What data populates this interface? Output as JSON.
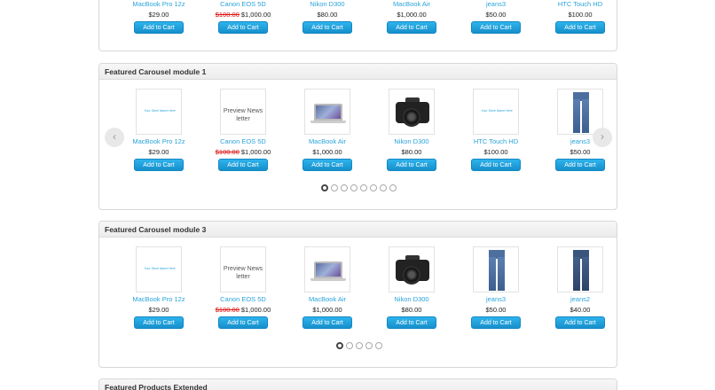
{
  "top_row": {
    "products": [
      {
        "name": "MacBook Pro 12z",
        "price": "$29.00",
        "old_price": "",
        "button": "Add to Cart"
      },
      {
        "name": "Canon EOS 5D",
        "price": "$1,000.00",
        "old_price": "$100.00",
        "button": "Add to Cart"
      },
      {
        "name": "Nikon D300",
        "price": "$80.00",
        "old_price": "",
        "button": "Add to Cart"
      },
      {
        "name": "MacBook Air",
        "price": "$1,000.00",
        "old_price": "",
        "button": "Add to Cart"
      },
      {
        "name": "jeans3",
        "price": "$50.00",
        "old_price": "",
        "button": "Add to Cart"
      },
      {
        "name": "HTC Touch HD",
        "price": "$100.00",
        "old_price": "",
        "button": "Add to Cart"
      }
    ]
  },
  "module1": {
    "title": "Featured Carousel module 1",
    "prev_icon": "chevron-left-icon",
    "next_icon": "chevron-right-icon",
    "prev_glyph": "‹",
    "next_glyph": "›",
    "dot_count": 8,
    "active_dot": 1,
    "products": [
      {
        "name": "MacBook Pro 12z",
        "price": "$29.00",
        "old_price": "",
        "button": "Add to Cart",
        "image": "logo"
      },
      {
        "name": "Canon EOS 5D",
        "price": "$1,000.00",
        "old_price": "$100.00",
        "button": "Add to Cart",
        "image": "placeholder"
      },
      {
        "name": "MacBook Air",
        "price": "$1,000.00",
        "old_price": "",
        "button": "Add to Cart",
        "image": "laptop"
      },
      {
        "name": "Nikon D300",
        "price": "$80.00",
        "old_price": "",
        "button": "Add to Cart",
        "image": "camera"
      },
      {
        "name": "HTC Touch HD",
        "price": "$100.00",
        "old_price": "",
        "button": "Add to Cart",
        "image": "logo"
      },
      {
        "name": "jeans3",
        "price": "$50.00",
        "old_price": "",
        "button": "Add to Cart",
        "image": "jeans"
      }
    ]
  },
  "module3": {
    "title": "Featured Carousel module 3",
    "dot_count": 5,
    "active_dot": 1,
    "products": [
      {
        "name": "MacBook Pro 12z",
        "price": "$29.00",
        "old_price": "",
        "button": "Add to Cart",
        "image": "logo"
      },
      {
        "name": "Canon EOS 5D",
        "price": "$1,000.00",
        "old_price": "$100.00",
        "button": "Add to Cart",
        "image": "placeholder"
      },
      {
        "name": "MacBook Air",
        "price": "$1,000.00",
        "old_price": "",
        "button": "Add to Cart",
        "image": "laptop"
      },
      {
        "name": "Nikon D300",
        "price": "$80.00",
        "old_price": "",
        "button": "Add to Cart",
        "image": "camera"
      },
      {
        "name": "jeans3",
        "price": "$50.00",
        "old_price": "",
        "button": "Add to Cart",
        "image": "jeans"
      },
      {
        "name": "jeans2",
        "price": "$40.00",
        "old_price": "",
        "button": "Add to Cart",
        "image": "jeans-dark"
      }
    ]
  },
  "placeholder_image_text": "Preview News letter",
  "logo_image_text": "Your Store Name Here",
  "module_extended": {
    "title": "Featured Products Extended"
  },
  "colors": {
    "link": "#29a3da",
    "button": "#168fcb",
    "old_price": "#dd1111"
  }
}
